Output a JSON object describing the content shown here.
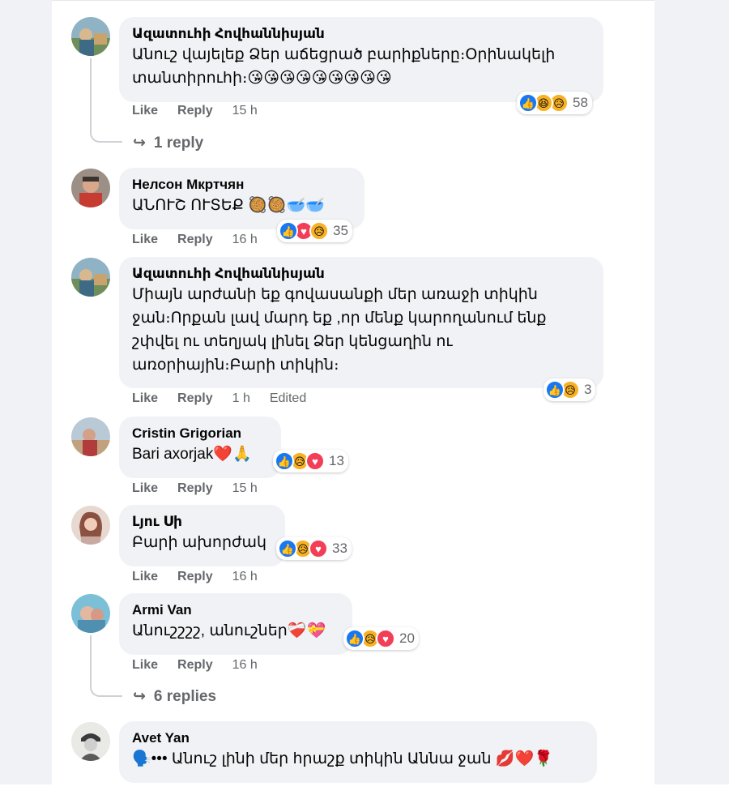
{
  "comments": [
    {
      "author": "Ազատուհի Հովհաննիսյան",
      "text": "Անուշ վայելեք Ձեր աճեցրած բարիքները։Օրինակելի տանտիրուհի։😘😘😘😘😘😘😘😘😘",
      "like": "Like",
      "reply": "Reply",
      "time": "15 h",
      "reactions": [
        "like",
        "haha",
        "sad"
      ],
      "reaction_count": "58",
      "replies_link": "1 reply"
    },
    {
      "author": "Нелсон Мкртчян",
      "text": "ԱՆՈՒՇ ՈՒՏԵՔ 🥘🥘🥣🥣",
      "like": "Like",
      "reply": "Reply",
      "time": "16 h",
      "reactions": [
        "like",
        "love",
        "sad"
      ],
      "reaction_count": "35"
    },
    {
      "author": "Ազատուհի Հովհաննիսյան",
      "text": "Միայն արժանի եք գովասանքի մեր առաջի տիկին ջան։Որքան լավ մարդ եք ,որ մենք կարողանում ենք շփվել ու տեղյակ լինել Ձեր կենցաղին ու առօրիային։Բարի տիկին։",
      "like": "Like",
      "reply": "Reply",
      "time": "1 h",
      "edited": "Edited",
      "reactions": [
        "like",
        "sad"
      ],
      "reaction_count": "3"
    },
    {
      "author": "Cristin Grigorian",
      "text": "Bari axorjak❤️🙏",
      "like": "Like",
      "reply": "Reply",
      "time": "15 h",
      "reactions": [
        "like",
        "sad",
        "love"
      ],
      "reaction_count": "13"
    },
    {
      "author": "Լյու Սի",
      "text": "Բարի ախորժակ",
      "like": "Like",
      "reply": "Reply",
      "time": "16 h",
      "reactions": [
        "like",
        "sad",
        "love"
      ],
      "reaction_count": "33"
    },
    {
      "author": "Armi Van",
      "text": "Անուշշշշ, անուշներ❤️‍🩹💝",
      "like": "Like",
      "reply": "Reply",
      "time": "16 h",
      "reactions": [
        "like",
        "sad",
        "love"
      ],
      "reaction_count": "20",
      "replies_link": "6 replies"
    },
    {
      "author": "Avet Yan",
      "text": "🗣️••• Անուշ լինի մեր հրաշք տիկին Աննա ջան 💋❤️🌹"
    }
  ],
  "icons": {
    "reply_arrow": "reply-arrow-icon",
    "reaction_like": "thumbs-up-icon",
    "reaction_love": "heart-icon",
    "reaction_haha": "laughing-face-icon",
    "reaction_sad": "sad-face-icon"
  },
  "colors": {
    "bubble": "#f0f2f5",
    "meta_text": "#65676b",
    "like_blue": "#1877f2",
    "love_red": "#f33e58",
    "sad_yellow": "#f7b125"
  }
}
